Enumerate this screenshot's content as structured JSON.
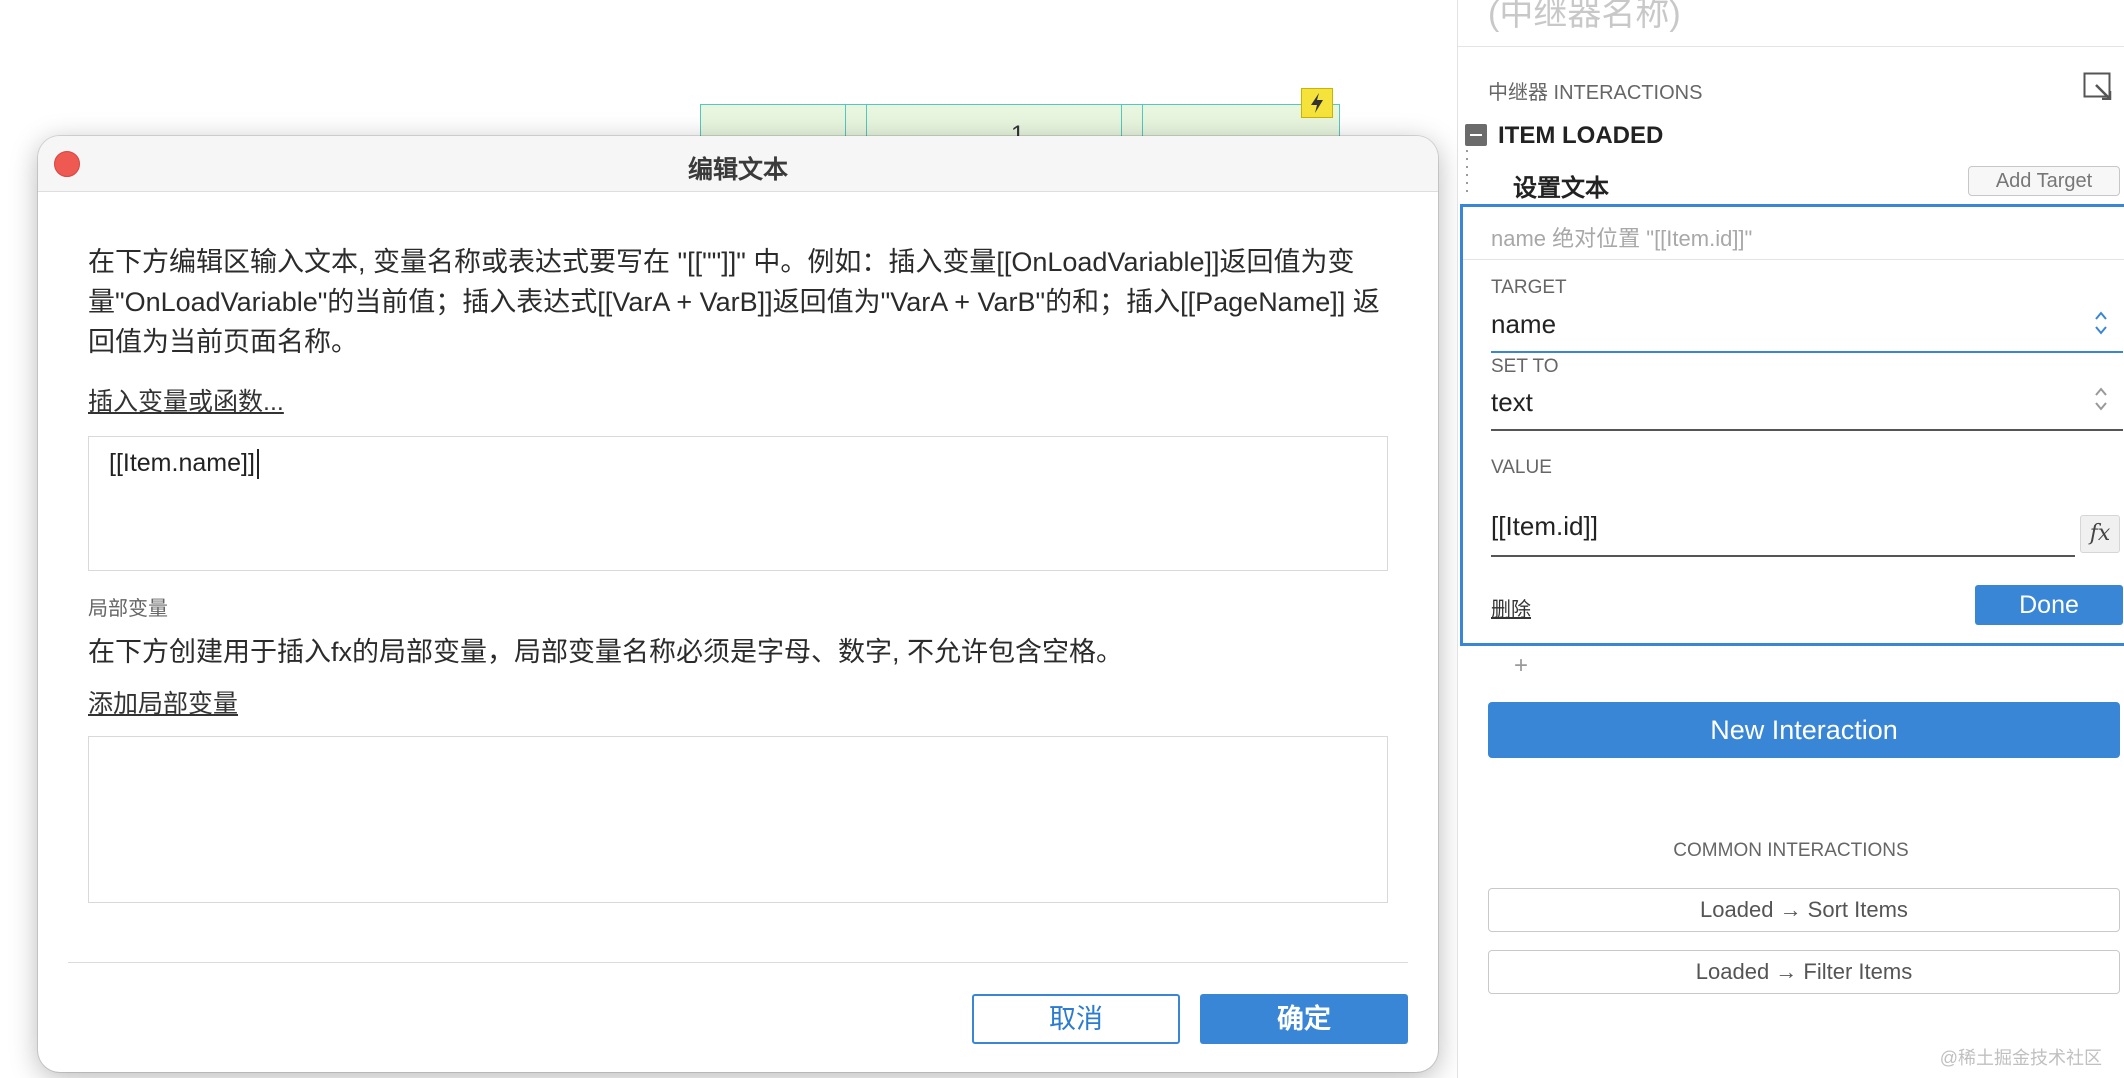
{
  "canvas": {
    "repeater_cell_text": "1"
  },
  "dialog": {
    "title": "编辑文本",
    "instruction": "在下方编辑区输入文本, 变量名称或表达式要写在 \"[[\"\"]]\" 中。例如：插入变量[[OnLoadVariable]]返回值为变量\"OnLoadVariable\"的当前值；插入表达式[[VarA + VarB]]返回值为\"VarA + VarB\"的和；插入[[PageName]] 返回值为当前页面名称。",
    "insert_link": "插入变量或函数...",
    "editor_value": "[[Item.name]]",
    "local_vars_label": "局部变量",
    "local_vars_desc": "在下方创建用于插入fx的局部变量，局部变量名称必须是字母、数字, 不允许包含空格。",
    "add_local_var_link": "添加局部变量",
    "cancel_label": "取消",
    "ok_label": "确定"
  },
  "panel": {
    "title": "(中继器名称)",
    "interactions_heading": "中继器 INTERACTIONS",
    "event_name": "ITEM LOADED",
    "action_name": "设置文本",
    "add_target_label": "Add Target",
    "action_summary": "name 绝对位置 \"[[Item.id]]\"",
    "target_label": "TARGET",
    "target_value": "name",
    "set_to_label": "SET TO",
    "set_to_value": "text",
    "value_label": "VALUE",
    "value_value": "[[Item.id]]",
    "fx_label": "fx",
    "delete_label": "删除",
    "done_label": "Done",
    "add_action_symbol": "+",
    "new_interaction_label": "New Interaction",
    "common_heading": "COMMON INTERACTIONS",
    "common_items": [
      "Loaded → Sort Items",
      "Loaded → Filter Items"
    ]
  },
  "watermark": "@稀土掘金技术社区",
  "colors": {
    "accent": "#3a86d6",
    "close_dot": "#ee5a52",
    "repeater_fill": "#e8f6df",
    "repeater_border": "#54c7be",
    "bolt_badge": "#f5e23a"
  },
  "icons": {
    "bolt": "lightning-bolt-icon",
    "expand": "expand-panel-icon",
    "collapse": "collapse-minus-icon",
    "spinner": "up-down-chevron-icon",
    "fx": "function-fx-icon"
  }
}
